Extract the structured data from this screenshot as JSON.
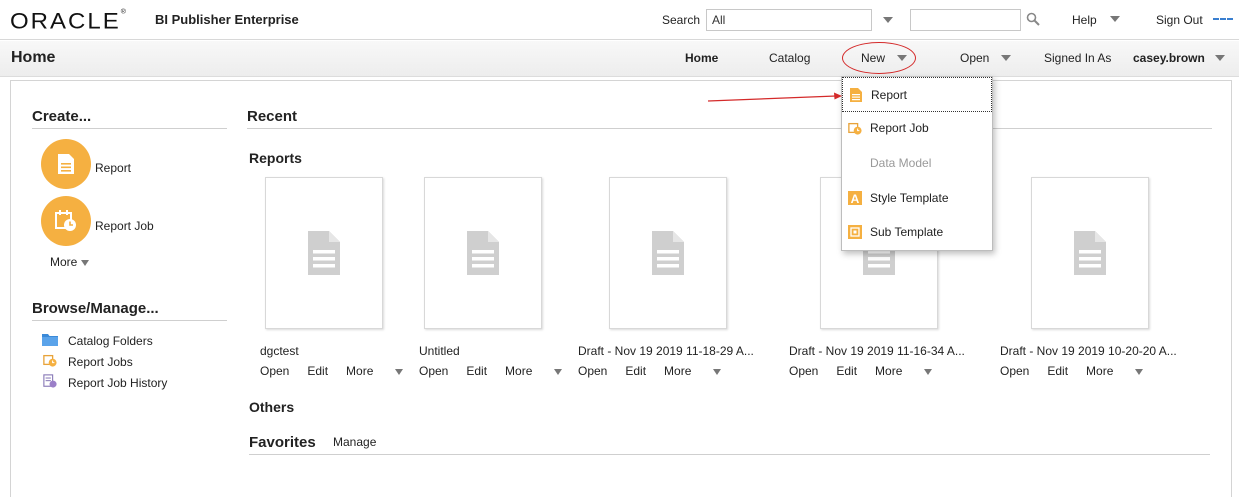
{
  "header": {
    "logo": "ORACLE",
    "product": "BI Publisher Enterprise",
    "search_label": "Search",
    "search_scope": "All",
    "help": "Help",
    "sign_out": "Sign Out"
  },
  "navbar": {
    "page_title": "Home",
    "home": "Home",
    "catalog": "Catalog",
    "new": "New",
    "open": "Open",
    "signed_in_as": "Signed In As",
    "user": "casey.brown"
  },
  "create": {
    "heading": "Create...",
    "items": [
      {
        "label": "Report",
        "icon": "report-icon"
      },
      {
        "label": "Report Job",
        "icon": "report-job-icon"
      }
    ],
    "more": "More"
  },
  "browse": {
    "heading": "Browse/Manage...",
    "items": [
      {
        "label": "Catalog Folders",
        "icon": "folder-icon"
      },
      {
        "label": "Report Jobs",
        "icon": "report-jobs-icon"
      },
      {
        "label": "Report Job History",
        "icon": "job-history-icon"
      }
    ]
  },
  "recent": {
    "heading": "Recent",
    "reports_heading": "Reports",
    "reports": [
      {
        "title": "dgctest",
        "open": "Open",
        "edit": "Edit",
        "more": "More"
      },
      {
        "title": "Untitled",
        "open": "Open",
        "edit": "Edit",
        "more": "More"
      },
      {
        "title": "Draft - Nov 19 2019 11-18-29 A...",
        "open": "Open",
        "edit": "Edit",
        "more": "More"
      },
      {
        "title": "Draft - Nov 19 2019 11-16-34 A...",
        "open": "Open",
        "edit": "Edit",
        "more": "More"
      },
      {
        "title": "Draft - Nov 19 2019 10-20-20 A...",
        "open": "Open",
        "edit": "Edit",
        "more": "More"
      }
    ],
    "others_heading": "Others"
  },
  "favorites": {
    "heading": "Favorites",
    "manage": "Manage"
  },
  "new_menu": {
    "items": [
      {
        "label": "Report",
        "icon": "report-icon",
        "state": "selected"
      },
      {
        "label": "Report Job",
        "icon": "report-job-icon",
        "state": "enabled"
      },
      {
        "label": "Data Model",
        "icon": "",
        "state": "disabled"
      },
      {
        "label": "Style Template",
        "icon": "style-template-icon",
        "state": "enabled"
      },
      {
        "label": "Sub Template",
        "icon": "sub-template-icon",
        "state": "enabled"
      }
    ]
  },
  "colors": {
    "accent_orange": "#f5b041",
    "annotation_red": "#d42a2a",
    "link_blue": "#3a7fd0"
  }
}
